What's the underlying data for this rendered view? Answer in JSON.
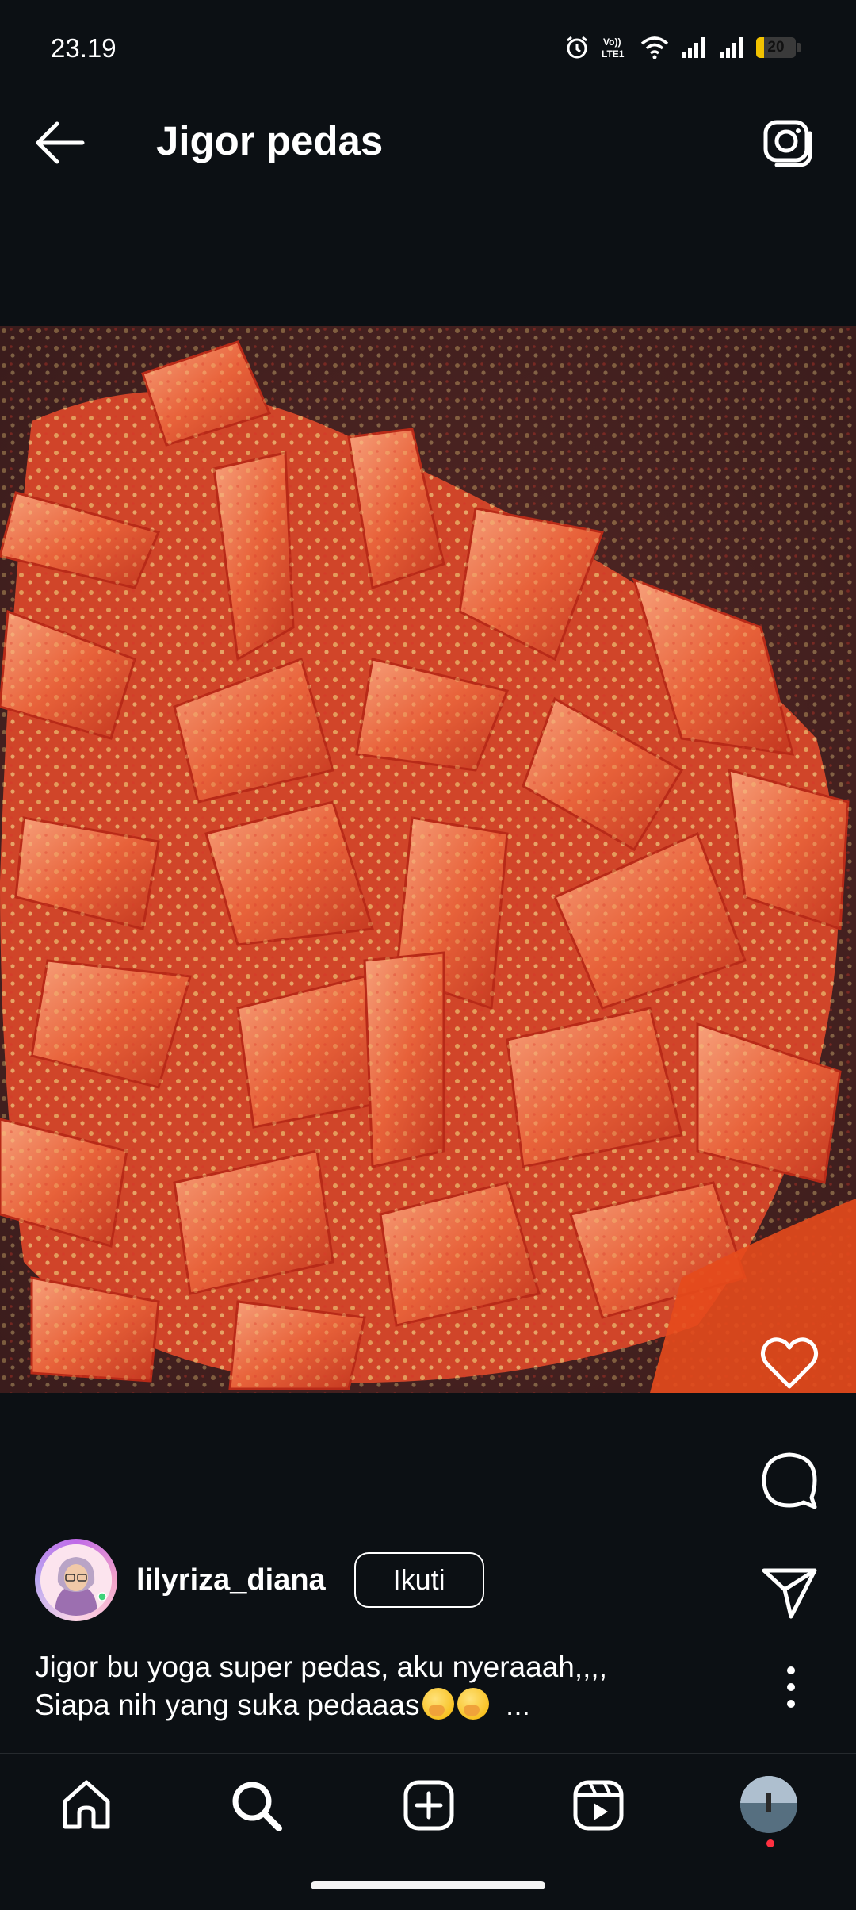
{
  "status_bar": {
    "time": "23.19",
    "network_label": "Vo)) LTE1",
    "battery": "20"
  },
  "header": {
    "title": "Jigor pedas"
  },
  "post": {
    "username": "lilyriza_diana",
    "follow_label": "Ikuti",
    "caption_line1": "Jigor bu yoga super pedas, aku nyeraaah,,,,",
    "caption_line2": "Siapa nih yang suka pedaaas",
    "caption_more": "...",
    "emojis": [
      "face-with-hand-over-mouth",
      "face-with-hand-over-mouth"
    ]
  },
  "actions": [
    "heart-icon",
    "comment-icon",
    "send-icon",
    "more-icon"
  ],
  "nav": [
    "home-icon",
    "search-icon",
    "create-icon",
    "reels-icon",
    "profile-avatar"
  ],
  "colors": {
    "background": "#0c1014",
    "text": "#ffffff",
    "notification_dot": "#ff3040",
    "battery": "#f2c200"
  }
}
